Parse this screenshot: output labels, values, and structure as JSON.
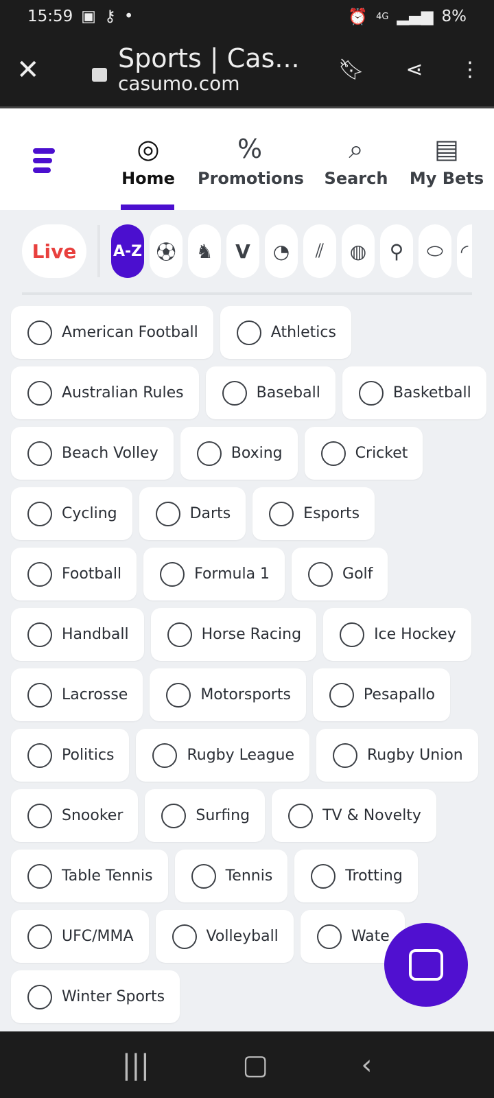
{
  "status": {
    "time": "15:59",
    "battery": "8%",
    "network": "4G",
    "icons": [
      "image-icon",
      "footsteps-icon",
      "key-icon",
      "dot-icon",
      "key-icon",
      "alarm-icon",
      "mute-icon",
      "volte-icon",
      "signal-icon",
      "battery-icon"
    ]
  },
  "browser": {
    "title": "Sports | Cas...",
    "url": "casumo.com"
  },
  "nav": {
    "tabs": [
      {
        "label": "Home",
        "icon": "stadium-icon"
      },
      {
        "label": "Promotions",
        "icon": "percent-badge-icon"
      },
      {
        "label": "Search",
        "icon": "search-icon"
      },
      {
        "label": "My Bets",
        "icon": "receipt-icon"
      }
    ],
    "active": "Home"
  },
  "strip": {
    "live": "Live",
    "az": "A-Z",
    "icons": [
      "football-icon",
      "horse-icon",
      "v-logo-icon",
      "tennis-icon",
      "cricket-icon",
      "basketball-icon",
      "golf-icon",
      "rugby-union-icon",
      "rugby-icon"
    ]
  },
  "sports": [
    [
      "American Football",
      "Athletics"
    ],
    [
      "Australian Rules",
      "Baseball",
      "Basketball"
    ],
    [
      "Beach Volley",
      "Boxing",
      "Cricket"
    ],
    [
      "Cycling",
      "Darts",
      "Esports"
    ],
    [
      "Football",
      "Formula 1",
      "Golf"
    ],
    [
      "Handball",
      "Horse Racing",
      "Ice Hockey"
    ],
    [
      "Lacrosse",
      "Motorsports",
      "Pesapallo"
    ],
    [
      "Politics",
      "Rugby League",
      "Rugby Union"
    ],
    [
      "Snooker",
      "Surfing",
      "TV & Novelty"
    ],
    [
      "Table Tennis",
      "Tennis",
      "Trotting"
    ],
    [
      "UFC/MMA",
      "Volleyball",
      "Wate"
    ],
    [
      "Winter Sports"
    ]
  ],
  "colors": {
    "accent": "#4b0fcf",
    "live": "#e8403e",
    "background": "#eef0f3"
  }
}
